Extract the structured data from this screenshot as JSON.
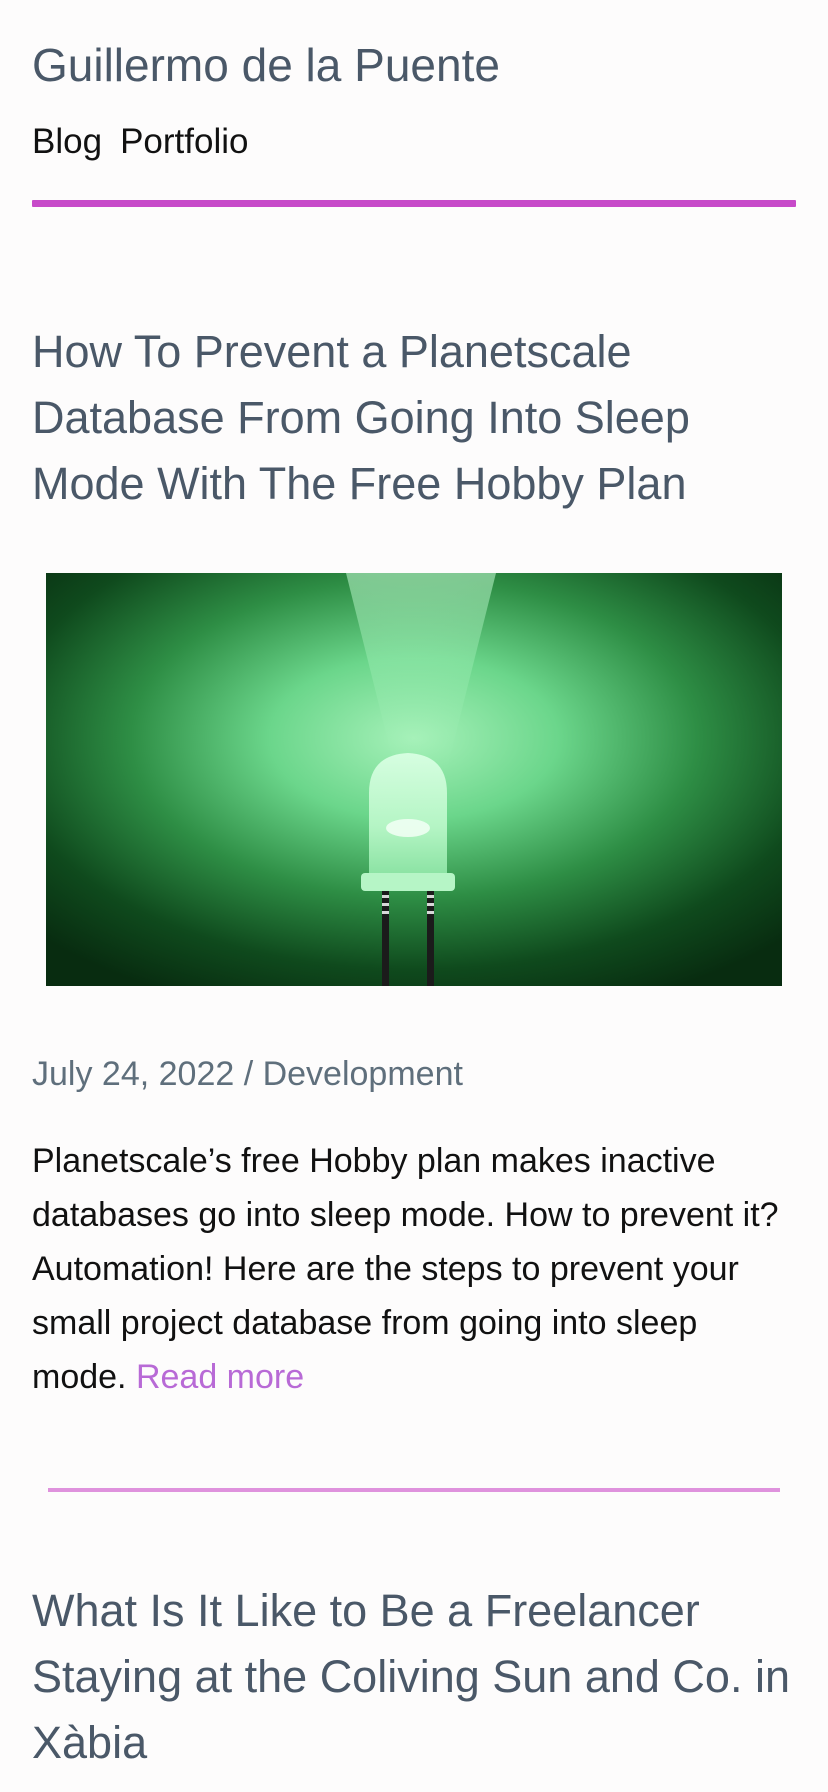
{
  "site": {
    "title": "Guillermo de la Puente",
    "nav": [
      "Blog",
      "Portfolio"
    ],
    "accent_color": "#c74ac9",
    "link_color": "#b86ad6"
  },
  "posts": [
    {
      "title": "How To Prevent a Planetscale Database From Going Into Sleep Mode With The Free Hobby Plan",
      "image": "green-led-image",
      "meta": "July 24, 2022 / Development",
      "excerpt": "Planetscale’s free Hobby plan makes inactive databases go into sleep mode. How to prevent it? Automation! Here are the steps to prevent your small project database from going into sleep mode.",
      "read_more": "Read more"
    },
    {
      "title": "What Is It Like to Be a Freelancer Staying at the Coliving Sun and Co. in Xàbia"
    }
  ]
}
